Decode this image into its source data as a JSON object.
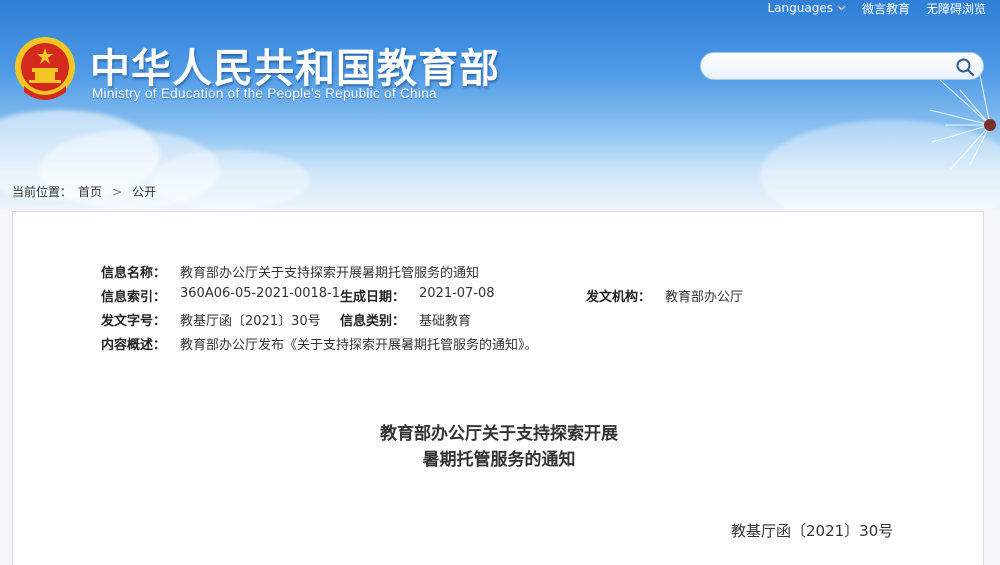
{
  "top_links": {
    "languages": "Languages",
    "weibo": "微言教育",
    "accessible": "无障碍浏览"
  },
  "site": {
    "title_cn": "中华人民共和国教育部",
    "title_en": "Ministry of Education of the People's Republic of China"
  },
  "search": {
    "placeholder": ""
  },
  "breadcrumb": {
    "prefix": "当前位置：",
    "home": "首页",
    "current": "公开"
  },
  "meta": {
    "name_label": "信息名称：",
    "name_value": "教育部办公厅关于支持探索开展暑期托管服务的通知",
    "index_label": "信息索引：",
    "index_value": "360A06-05-2021-0018-1",
    "date_label": "生成日期：",
    "date_value": "2021-07-08",
    "org_label": "发文机构：",
    "org_value": "教育部办公厅",
    "docno_label": "发文字号：",
    "docno_value": "教基厅函〔2021〕30号",
    "category_label": "信息类别：",
    "category_value": "基础教育",
    "summary_label": "内容概述：",
    "summary_value": "教育部办公厅发布《关于支持探索开展暑期托管服务的通知》。"
  },
  "document": {
    "title_line1": "教育部办公厅关于支持探索开展",
    "title_line2": "暑期托管服务的通知",
    "number": "教基厅函〔2021〕30号"
  },
  "colors": {
    "header_top": "#2f7fd8",
    "header_bottom": "#eef5fc",
    "emblem_red": "#d42a1e",
    "emblem_gold": "#f3c623"
  }
}
